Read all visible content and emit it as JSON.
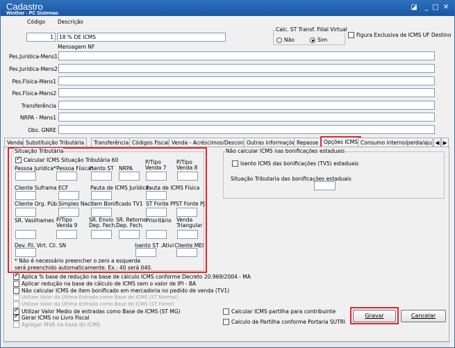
{
  "window": {
    "title": "Cadastro",
    "subtitle": "Winthor - PC Sistemas"
  },
  "header": {
    "codigo_label": "Código",
    "codigo_value": "1",
    "descricao_label": "Descrição",
    "descricao_value": "18 % DE ICMS",
    "calc_st_label": "Calc. ST Transf. Filial Virtual",
    "nao_label": "Não",
    "sim_label": "Sim",
    "figura_label": "Figura Exclusiva de ICMS UF Destino",
    "mensagem_label": "Mensagem NF"
  },
  "messages": [
    {
      "label": "Pes.Jurídica-Mens1"
    },
    {
      "label": "Pes.Jurídica-Mens2"
    },
    {
      "label": "Pes.Física-Mens1"
    },
    {
      "label": "Pes.Física-Mens2"
    },
    {
      "label": "Transferência"
    },
    {
      "label": "NRPA - Mens1"
    },
    {
      "label": "Obs. GNRE"
    }
  ],
  "tabs": [
    "Venda",
    "Substituição Tributária",
    "Transferência",
    "Códigos Fiscais",
    "Venda - Acréscimos/Descontos",
    "Outras informações",
    "Repasse",
    "Opções ICMS",
    "Consumo interno/perda/ajuste"
  ],
  "st": {
    "group_title": "Situação Tributária",
    "calc_label": "Calcular ICMS Situação Tributária 60",
    "row1": [
      "Pessoa Jurídica*",
      "Pessoa Física*",
      "Isento ST",
      "NRPA",
      "P/Tipo Venda 7",
      "P/Tipo Venda 8"
    ],
    "row2": [
      "Cliente Suframa",
      "ECF",
      "Pauta de ICMS Jurídica",
      "Pauta de ICMS Física"
    ],
    "row3": [
      "Cliente Org. Púb.",
      "Simples Nac.",
      "Item Bonificado TV1",
      "ST Fonte PF",
      "ST Fonte PJ"
    ],
    "row4": [
      "SR. Vasilhames",
      "P/Tipo Venda 9",
      "SR. Envio Dep. Fech.",
      "SR. Retorno Dep. Fech.",
      "Prioritário",
      "Venda Triangular"
    ],
    "row5": [
      "Dev. Fil. Virt. Cli. SN",
      "Isento ST .Ativi",
      "Cliente MEI"
    ],
    "note1": "* Não é necessário preencher o zero a esquerda",
    "note2": "será preenchido automaticamente.  Ex.: 40 será 040."
  },
  "bonif": {
    "group_title": "Não calcular ICMS nas bonificações estaduais",
    "isento_label": "Isento ICMS das bonificações (TV5) estaduais",
    "situacao_label": "Situação Tributaria das bonificações estaduais"
  },
  "options": [
    {
      "label": "Aplica % base de redução na base de cálculo ICMS conforme Decreto 20.969/2004 - MA",
      "checked": true,
      "disabled": false
    },
    {
      "label": "Aplicar redução na base de cálculo de ICMS sem o valor de IPI - BA",
      "checked": false,
      "disabled": false
    },
    {
      "label": "Não calcular ICMS de item bonificado em mercadoria no pedido de venda (TV1)",
      "checked": false,
      "disabled": false
    },
    {
      "label": "Utilizar Valor da Última Entrada como Base de ICMS (ST Normal)",
      "checked": false,
      "disabled": true
    },
    {
      "label": "Utilizar Valor da Última Entrada como Base de ICMS (ST Fonte)",
      "checked": false,
      "disabled": true
    },
    {
      "label": "Utilizar Valor Medio de entradas como Base de ICMS (ST MG)",
      "checked": true,
      "disabled": false
    },
    {
      "label": "Gerar ICMS no Livro Fiscal",
      "checked": true,
      "disabled": false
    },
    {
      "label": "Agregar MVA na base do ICMS",
      "checked": false,
      "disabled": true
    }
  ],
  "right_options": [
    {
      "label": "Calcular ICMS partilha para contribuinte"
    },
    {
      "label": "Calculo de Partilha conforme Portaria SUTRI"
    }
  ],
  "buttons": {
    "gravar": "Gravar",
    "cancelar": "Cancelar"
  }
}
